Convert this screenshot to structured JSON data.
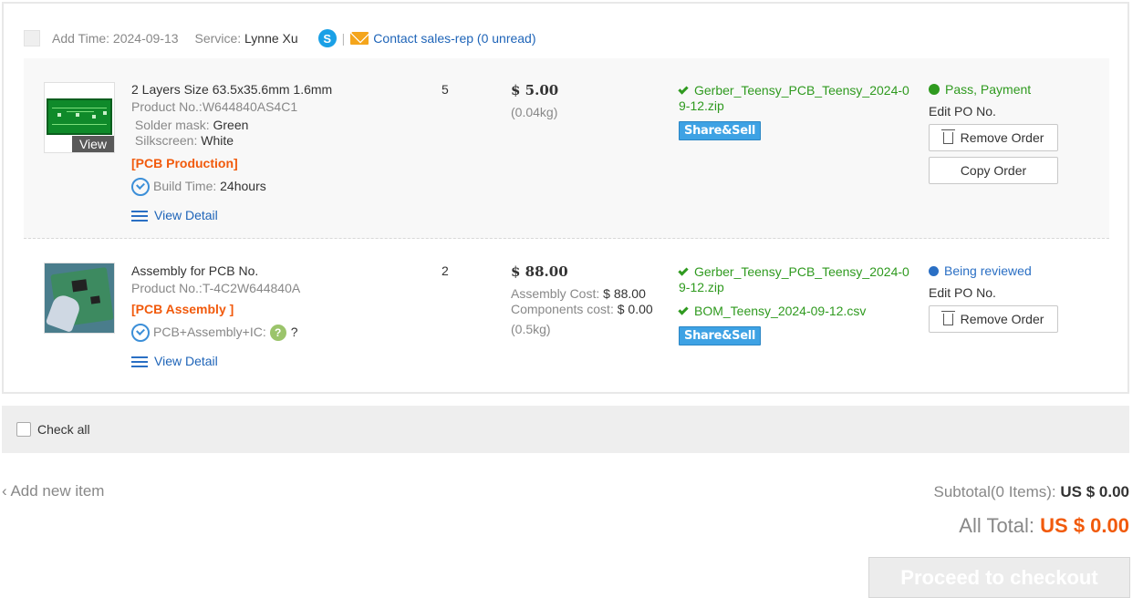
{
  "order": {
    "add_time_label": "Add Time:",
    "add_time": "2024-09-13",
    "service_label": "Service:",
    "service": "Lynne Xu",
    "separator": "|",
    "contact_link": "Contact sales-rep (0 unread)",
    "skype_glyph": "S"
  },
  "items": [
    {
      "title": "2 Layers Size 63.5x35.6mm 1.6mm",
      "product_label": "Product No.:",
      "product_no": "W644840AS4C1",
      "solder_label": "Solder mask:",
      "solder": "Green",
      "silk_label": "Silkscreen:",
      "silk": "White",
      "tag": "[PCB Production]",
      "build_label": "Build Time:",
      "build": "24hours",
      "view_detail": "View Detail",
      "view_tag": "View",
      "qty": "5",
      "price": "$ 5.00",
      "weight": "(0.04kg)",
      "files": [
        "Gerber_Teensy_PCB_Teensy_2024-09-12.zip"
      ],
      "share_label": "Share&Sell",
      "status": "Pass, Payment",
      "status_color": "#2f9a1f",
      "edit_po": "Edit PO No.",
      "remove_btn": "Remove Order",
      "copy_btn": "Copy Order"
    },
    {
      "title": "Assembly for PCB No.",
      "product_label": "Product No.:",
      "product_no": "T-4C2W644840A",
      "tag": "[PCB Assembly ]",
      "build_label": "PCB+Assembly+IC:",
      "help_glyph": "?",
      "build": "?",
      "view_detail": "View Detail",
      "qty": "2",
      "price": "$ 88.00",
      "assembly_cost_label": "Assembly Cost:",
      "assembly_cost": "$ 88.00",
      "components_cost_label": "Components cost:",
      "components_cost": "$ 0.00",
      "weight": "(0.5kg)",
      "files": [
        "Gerber_Teensy_PCB_Teensy_2024-09-12.zip",
        "BOM_Teensy_2024-09-12.csv"
      ],
      "share_label": "Share&Sell",
      "status": "Being reviewed",
      "status_color": "#2a6fc4",
      "edit_po": "Edit PO No.",
      "remove_btn": "Remove Order"
    }
  ],
  "footer": {
    "check_all": "Check all",
    "add_new": "‹ Add new item",
    "subtotal_label": "Subtotal(0 Items):",
    "subtotal": "US $ 0.00",
    "all_total_label": "All Total:",
    "all_total": "US $ 0.00",
    "checkout": "Proceed to checkout"
  },
  "colors": {
    "accent_orange": "#f15a0c",
    "link_blue": "#1e64b8",
    "success_green": "#2f9a1f"
  }
}
